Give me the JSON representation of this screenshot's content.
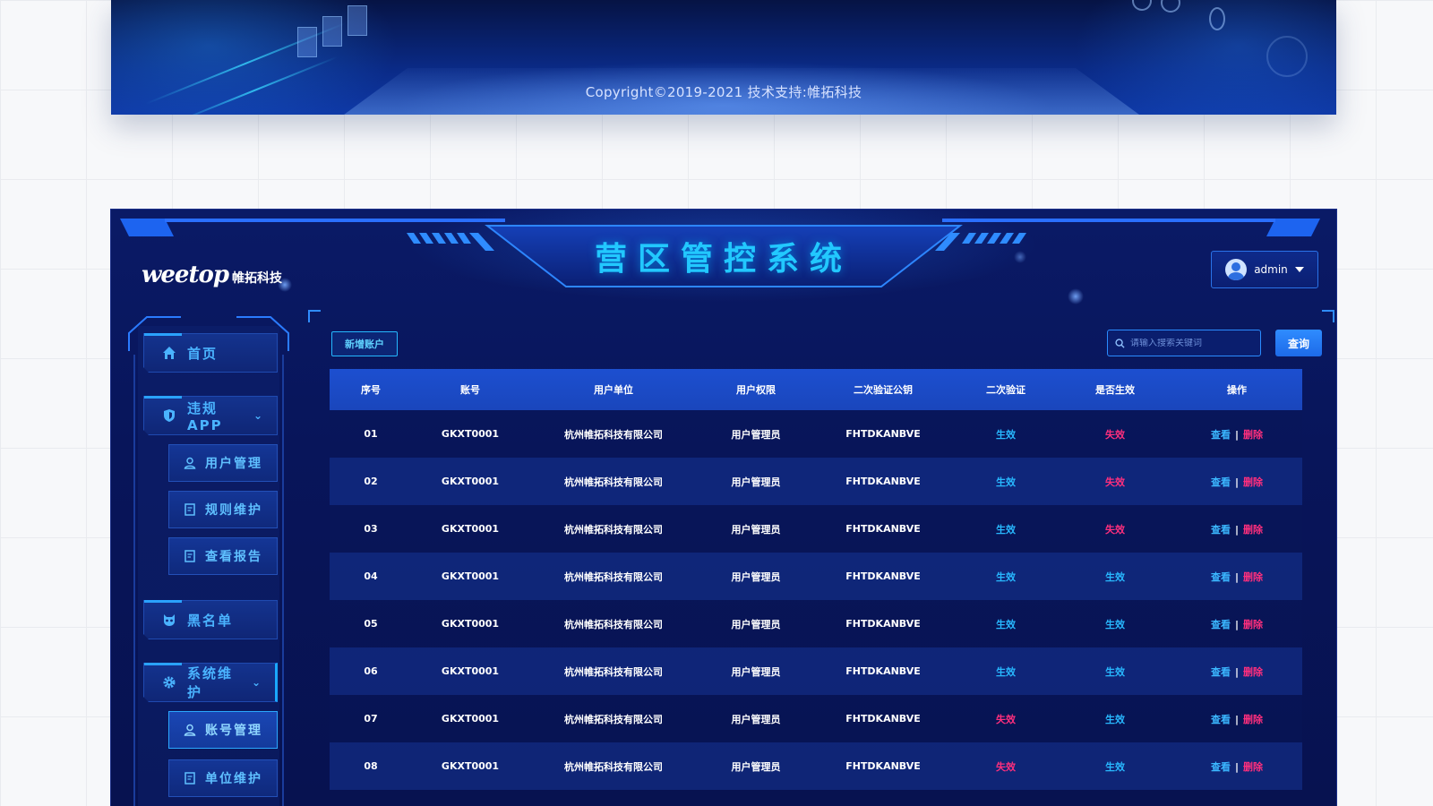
{
  "banner": {
    "copyright": "Copyright©2019-2021    技术支持:帷拓科技"
  },
  "header": {
    "title": "营区管控系统",
    "logo_mark": "weetop",
    "logo_text": "帷拓科技",
    "user": "admin"
  },
  "sidebar": {
    "items": [
      {
        "label": "首页",
        "icon": "home-icon"
      },
      {
        "label": "违规APP",
        "icon": "shield-icon"
      },
      {
        "label": "用户管理",
        "icon": "user-icon"
      },
      {
        "label": "规则维护",
        "icon": "document-icon"
      },
      {
        "label": "查看报告",
        "icon": "document-icon"
      },
      {
        "label": "黑名单",
        "icon": "mask-icon"
      },
      {
        "label": "系统维护",
        "icon": "gear-icon"
      },
      {
        "label": "账号管理",
        "icon": "user-icon"
      },
      {
        "label": "单位维护",
        "icon": "document-icon"
      }
    ]
  },
  "toolbar": {
    "add_label": "新增账户",
    "search_placeholder": "请输入搜索关键词",
    "query_label": "查询"
  },
  "table": {
    "headers": [
      "序号",
      "账号",
      "用户单位",
      "用户权限",
      "二次验证公钥",
      "二次验证",
      "是否生效",
      "操作"
    ],
    "rows": [
      {
        "no": "01",
        "account": "GKXT0001",
        "unit": "杭州帷拓科技有限公司",
        "role": "用户管理员",
        "key": "FHTDKANBVE",
        "verify": "生效",
        "active": "失效"
      },
      {
        "no": "02",
        "account": "GKXT0001",
        "unit": "杭州帷拓科技有限公司",
        "role": "用户管理员",
        "key": "FHTDKANBVE",
        "verify": "生效",
        "active": "失效"
      },
      {
        "no": "03",
        "account": "GKXT0001",
        "unit": "杭州帷拓科技有限公司",
        "role": "用户管理员",
        "key": "FHTDKANBVE",
        "verify": "生效",
        "active": "失效"
      },
      {
        "no": "04",
        "account": "GKXT0001",
        "unit": "杭州帷拓科技有限公司",
        "role": "用户管理员",
        "key": "FHTDKANBVE",
        "verify": "生效",
        "active": "生效"
      },
      {
        "no": "05",
        "account": "GKXT0001",
        "unit": "杭州帷拓科技有限公司",
        "role": "用户管理员",
        "key": "FHTDKANBVE",
        "verify": "生效",
        "active": "生效"
      },
      {
        "no": "06",
        "account": "GKXT0001",
        "unit": "杭州帷拓科技有限公司",
        "role": "用户管理员",
        "key": "FHTDKANBVE",
        "verify": "生效",
        "active": "生效"
      },
      {
        "no": "07",
        "account": "GKXT0001",
        "unit": "杭州帷拓科技有限公司",
        "role": "用户管理员",
        "key": "FHTDKANBVE",
        "verify": "失效",
        "active": "生效"
      },
      {
        "no": "08",
        "account": "GKXT0001",
        "unit": "杭州帷拓科技有限公司",
        "role": "用户管理员",
        "key": "FHTDKANBVE",
        "verify": "失效",
        "active": "生效"
      }
    ],
    "op_view": "查看",
    "op_sep": "|",
    "op_delete": "删除",
    "status_on": "生效",
    "status_off": "失效"
  },
  "colors": {
    "accent": "#22c8ff",
    "status_on": "#28b8ff",
    "status_off": "#ff2f7d",
    "header_row": "#1c4fd0",
    "background": "#08155a"
  }
}
